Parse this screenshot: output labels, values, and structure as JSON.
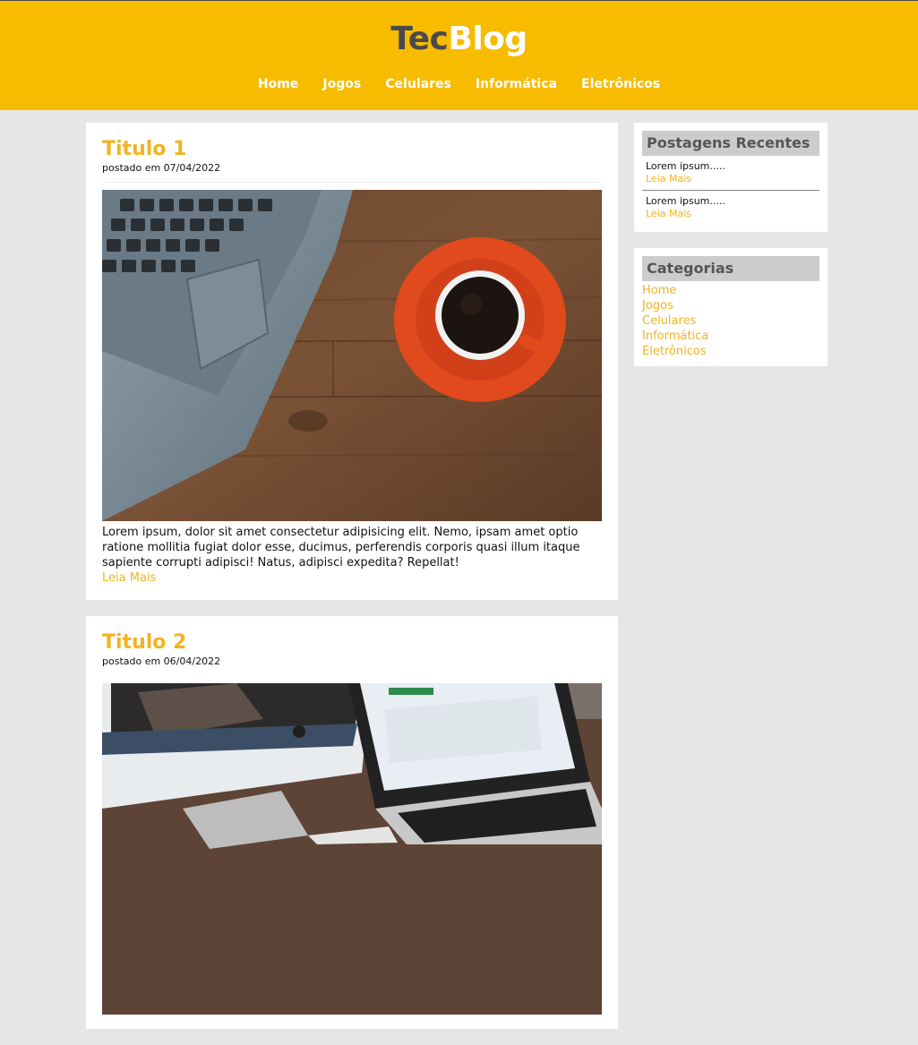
{
  "logo": {
    "part1": "Tec",
    "part2": "Blog"
  },
  "nav": [
    "Home",
    "Jogos",
    "Celulares",
    "Informática",
    "Eletrônicos"
  ],
  "posts": [
    {
      "title": "Titulo 1",
      "meta": "postado em 07/04/2022",
      "text": "Lorem ipsum, dolor sit amet consectetur adipisicing elit. Nemo, ipsam amet optio ratione mollitia fugiat dolor esse, ducimus, perferendis corporis quasi illum itaque sapiente corrupti adipisci! Natus, adipisci expedita? Repellat!",
      "read_more": "Leia Mais"
    },
    {
      "title": "Titulo 2",
      "meta": "postado em 06/04/2022"
    }
  ],
  "sidebar": {
    "recent": {
      "title": "Postagens Recentes",
      "items": [
        {
          "text": "Lorem ipsum.....",
          "link": "Leia Mais"
        },
        {
          "text": "Lorem ipsum.....",
          "link": "Leia Mais"
        }
      ]
    },
    "categories": {
      "title": "Categorias",
      "items": [
        "Home",
        "Jogos",
        "Celulares",
        "Informática",
        "Eletrônicos"
      ]
    }
  },
  "colors": {
    "brand": "#f7bb00",
    "accent": "#f2b321",
    "background": "#e6e6e6"
  }
}
